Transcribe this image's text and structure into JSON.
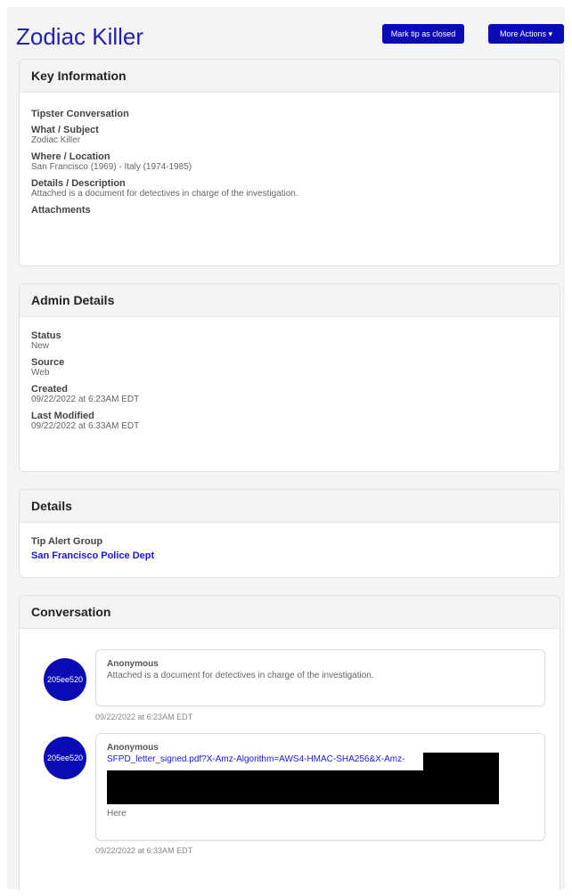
{
  "header": {
    "title": "Zodiac Killer",
    "close_label": "Mark tip as closed",
    "more_label": "More Actions ▾"
  },
  "key_info": {
    "title": "Key Information",
    "conversation_heading": "Tipster Conversation",
    "what_label": "What / Subject",
    "what_value": "Zodiac Killer",
    "where_label": "Where / Location",
    "where_value": "San Francisco (1969) - Italy (1974-1985)",
    "details_label": "Details / Description",
    "details_value": "Attached is a document for detectives in charge of the investigation.",
    "attachments_label": "Attachments"
  },
  "admin": {
    "title": "Admin Details",
    "status_label": "Status",
    "status_value": "New",
    "source_label": "Source",
    "source_value": "Web",
    "created_label": "Created",
    "created_value": "09/22/2022 at 6:23AM EDT",
    "modified_label": "Last Modified",
    "modified_value": "09/22/2022 at 6:33AM EDT"
  },
  "details": {
    "title": "Details",
    "group_label": "Tip Alert Group",
    "group_value": "San Francisco Police Dept"
  },
  "conversation": {
    "title": "Conversation",
    "messages": [
      {
        "avatar": "205ee520",
        "author": "Anonymous",
        "text": "Attached is a document for detectives in charge of the investigation.",
        "time": "09/22/2022 at 6:23AM EDT"
      },
      {
        "avatar": "205ee520",
        "author": "Anonymous",
        "link": "SFPD_letter_signed.pdf?X-Amz-Algorithm=AWS4-HMAC-SHA256&X-Amz-",
        "text": "Here",
        "time": "09/22/2022 at 6:33AM EDT"
      }
    ]
  },
  "colors": {
    "accent": "#0b0bb5",
    "title": "#2222aa",
    "link": "#1a1ad0"
  }
}
